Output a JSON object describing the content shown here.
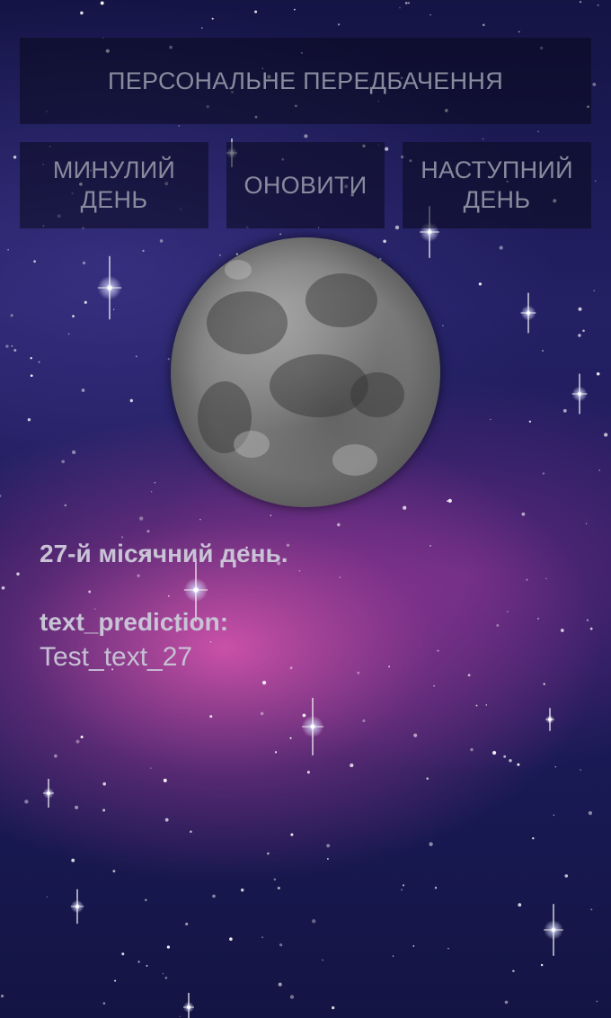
{
  "buttons": {
    "personal": "ПЕРСОНАЛЬНЕ ПЕРЕДБАЧЕННЯ",
    "prev": "МИНУЛИЙ\nДЕНЬ",
    "refresh": "ОНОВИТИ",
    "next": "НАСТУПНИЙ\nДЕНЬ"
  },
  "content": {
    "day_title": "27-й місячний день.",
    "prediction_label": "text_prediction:",
    "prediction_text": "Test_text_27"
  },
  "images": {
    "background": "starry-night-sky",
    "moon": "moon-image"
  },
  "colors": {
    "button_bg": "#0a0a1e",
    "button_text": "#8a8a9e",
    "body_text": "#c9c3d6"
  }
}
